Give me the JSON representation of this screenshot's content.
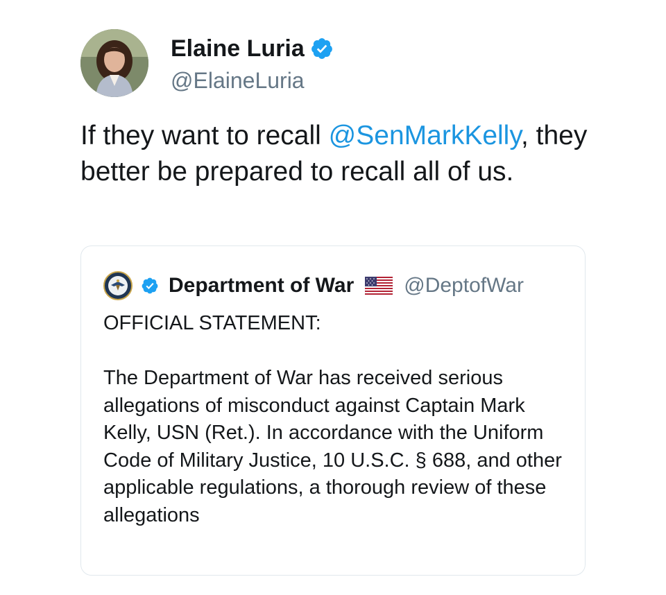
{
  "author": {
    "display_name": "Elaine Luria",
    "handle": "@ElaineLuria",
    "verified": true,
    "avatar_icon": "avatar-photo"
  },
  "tweet": {
    "text_before": "If they want to recall ",
    "mention": "@SenMarkKelly",
    "text_after": ", they better be prepared to recall all of us."
  },
  "quoted_tweet": {
    "display_name": "Department of War",
    "handle": "@DeptofWar",
    "verified": true,
    "flag_icon": "us-flag-icon",
    "avatar_icon": "department-seal-icon",
    "title": "OFFICIAL STATEMENT:",
    "body": "The Department of War has received serious allegations of misconduct against Captain Mark Kelly, USN (Ret.). In accordance with the Uniform Code of Military Justice, 10 U.S.C. § 688, and other applicable regulations, a thorough review of these allegations"
  },
  "colors": {
    "link": "#1b95e0",
    "verified": "#1da1f2",
    "text": "#14171a",
    "muted": "#657786",
    "border": "#e1e8ed"
  }
}
